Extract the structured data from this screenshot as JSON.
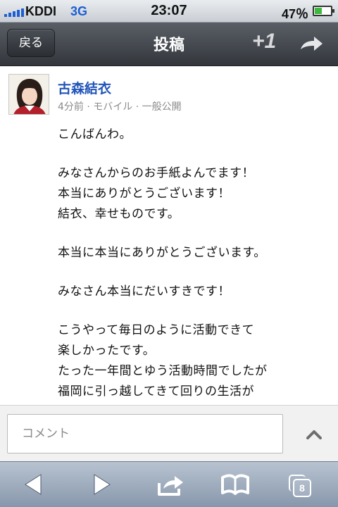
{
  "status_bar": {
    "carrier": "KDDI",
    "network": "3G",
    "time": "23:07",
    "battery_percent_label": "47％",
    "battery_level": 0.47
  },
  "nav": {
    "back_label": "戻る",
    "title": "投稿",
    "plus_one_label": "+1",
    "share_icon": "share-arrow-icon"
  },
  "post": {
    "author": "古森結衣",
    "meta": "4分前 · モバイル · 一般公開",
    "paragraphs": [
      [
        "こんばんわ。"
      ],
      [
        "みなさんからのお手紙よんでます！",
        "本当にありがとうございます！",
        "結衣、幸せものです。"
      ],
      [
        "本当に本当にありがとうございます。"
      ],
      [
        "みなさん本当にだいすきです！"
      ],
      [
        "こうやって毎日のように活動できて",
        "楽しかったです。",
        "たった一年間とゆう活動時間でしたが",
        "福岡に引っ越してきて回りの生活が"
      ]
    ]
  },
  "comment": {
    "placeholder": "コメント",
    "expand_icon": "chevron-up-icon"
  },
  "toolbar": {
    "back_icon": "back-arrow-icon",
    "forward_icon": "forward-arrow-icon",
    "share_icon": "share-box-icon",
    "bookmarks_icon": "book-icon",
    "tabs_count": "8"
  },
  "colors": {
    "link_blue": "#2154b8",
    "nav_bar": "#3e4247",
    "toolbar": "#9aa8ba"
  }
}
